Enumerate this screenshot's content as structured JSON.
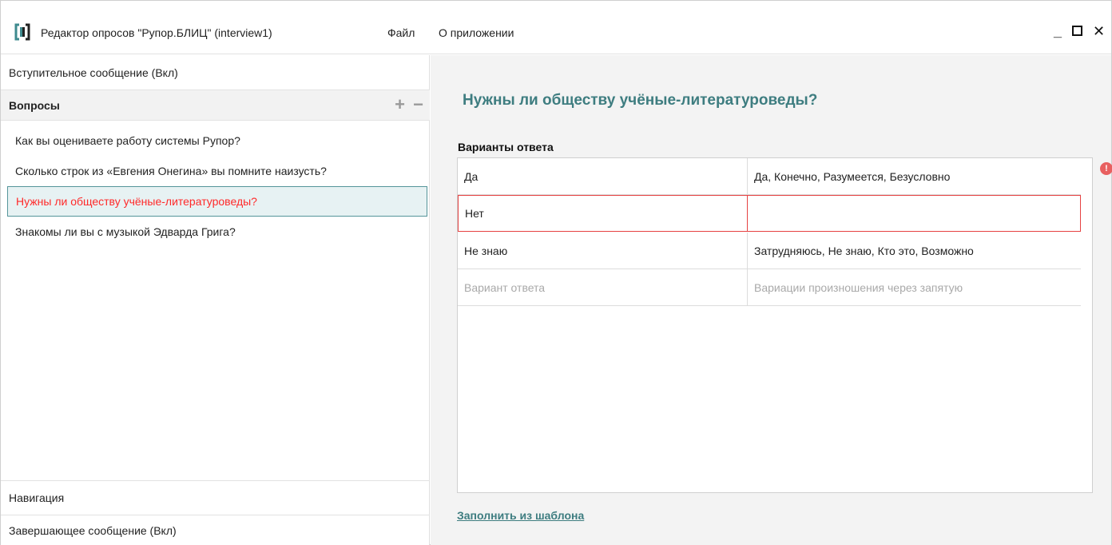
{
  "window": {
    "title": "Редактор опросов \"Рупор.БЛИЦ\" (interview1)",
    "menu": {
      "file": "Файл",
      "about": "О приложении"
    },
    "controls": {
      "minimize": "_",
      "close": "✕"
    }
  },
  "sidebar": {
    "intro": "Вступительное сообщение (Вкл)",
    "questions_header": "Вопросы",
    "add": "+",
    "remove": "−",
    "questions": [
      "Как вы оцениваете работу системы Рупор?",
      "Сколько строк из «Евгения Онегина» вы помните наизусть?",
      "Нужны ли обществу учёные-литературоведы?",
      "Знакомы ли вы с музыкой Эдварда Грига?"
    ],
    "navigation": "Навигация",
    "outro": "Завершающее сообщение (Вкл)"
  },
  "editor": {
    "question_title": "Нужны ли обществу учёные-литературоведы?",
    "answers_label": "Варианты ответа",
    "rows": [
      {
        "answer": "Да",
        "variants": "Да, Конечно, Разумеется, Безусловно"
      },
      {
        "answer": "Нет",
        "variants": ""
      },
      {
        "answer": "Не знаю",
        "variants": "Затрудняюсь, Не знаю, Кто это, Возможно"
      }
    ],
    "placeholder_answer": "Вариант ответа",
    "placeholder_variants": "Вариации произношения через запятую",
    "error_mark": "!",
    "template_link": "Заполнить из шаблона"
  },
  "colors": {
    "accent": "#3e7d80",
    "error": "#e64242",
    "selected_text": "#ff2a2a"
  }
}
